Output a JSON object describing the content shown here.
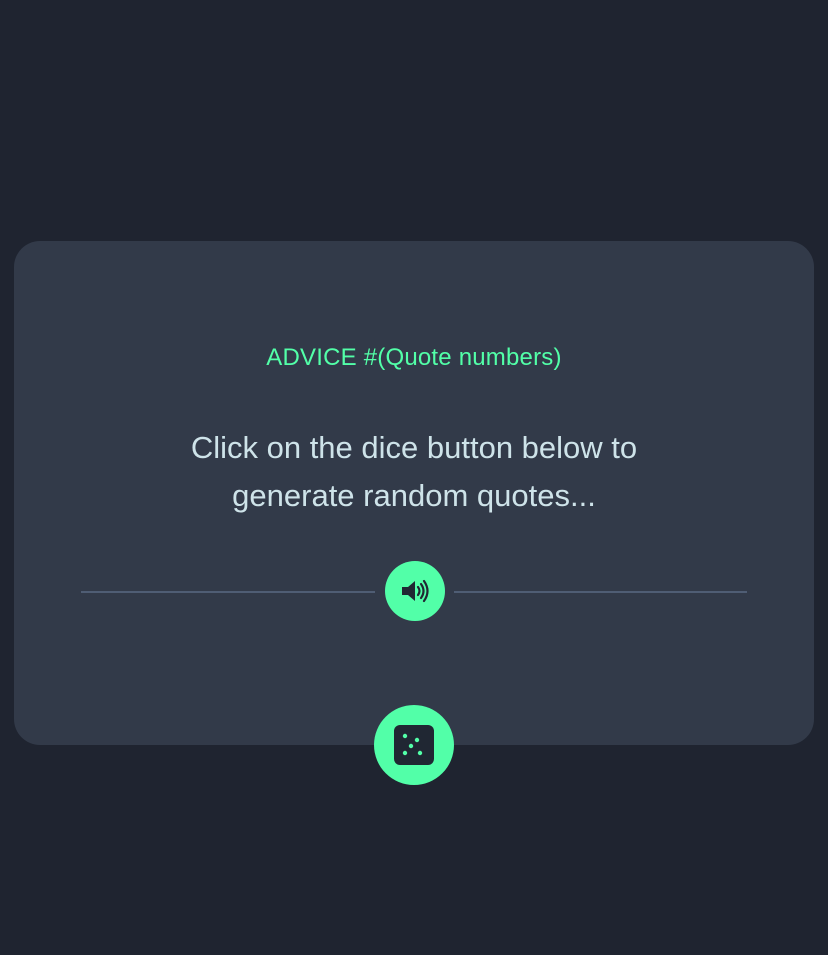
{
  "advice": {
    "title": "ADVICE #(Quote numbers)",
    "quote": "Click on the dice button below to generate random quotes..."
  },
  "icons": {
    "speaker": "speaker-icon",
    "dice": "dice-icon"
  },
  "colors": {
    "page_background": "#1f2430",
    "card_background": "#323a49",
    "accent": "#52ffa8",
    "quote_text": "#cee3e9",
    "divider": "#4f5d74",
    "icon_dark": "#202733"
  }
}
